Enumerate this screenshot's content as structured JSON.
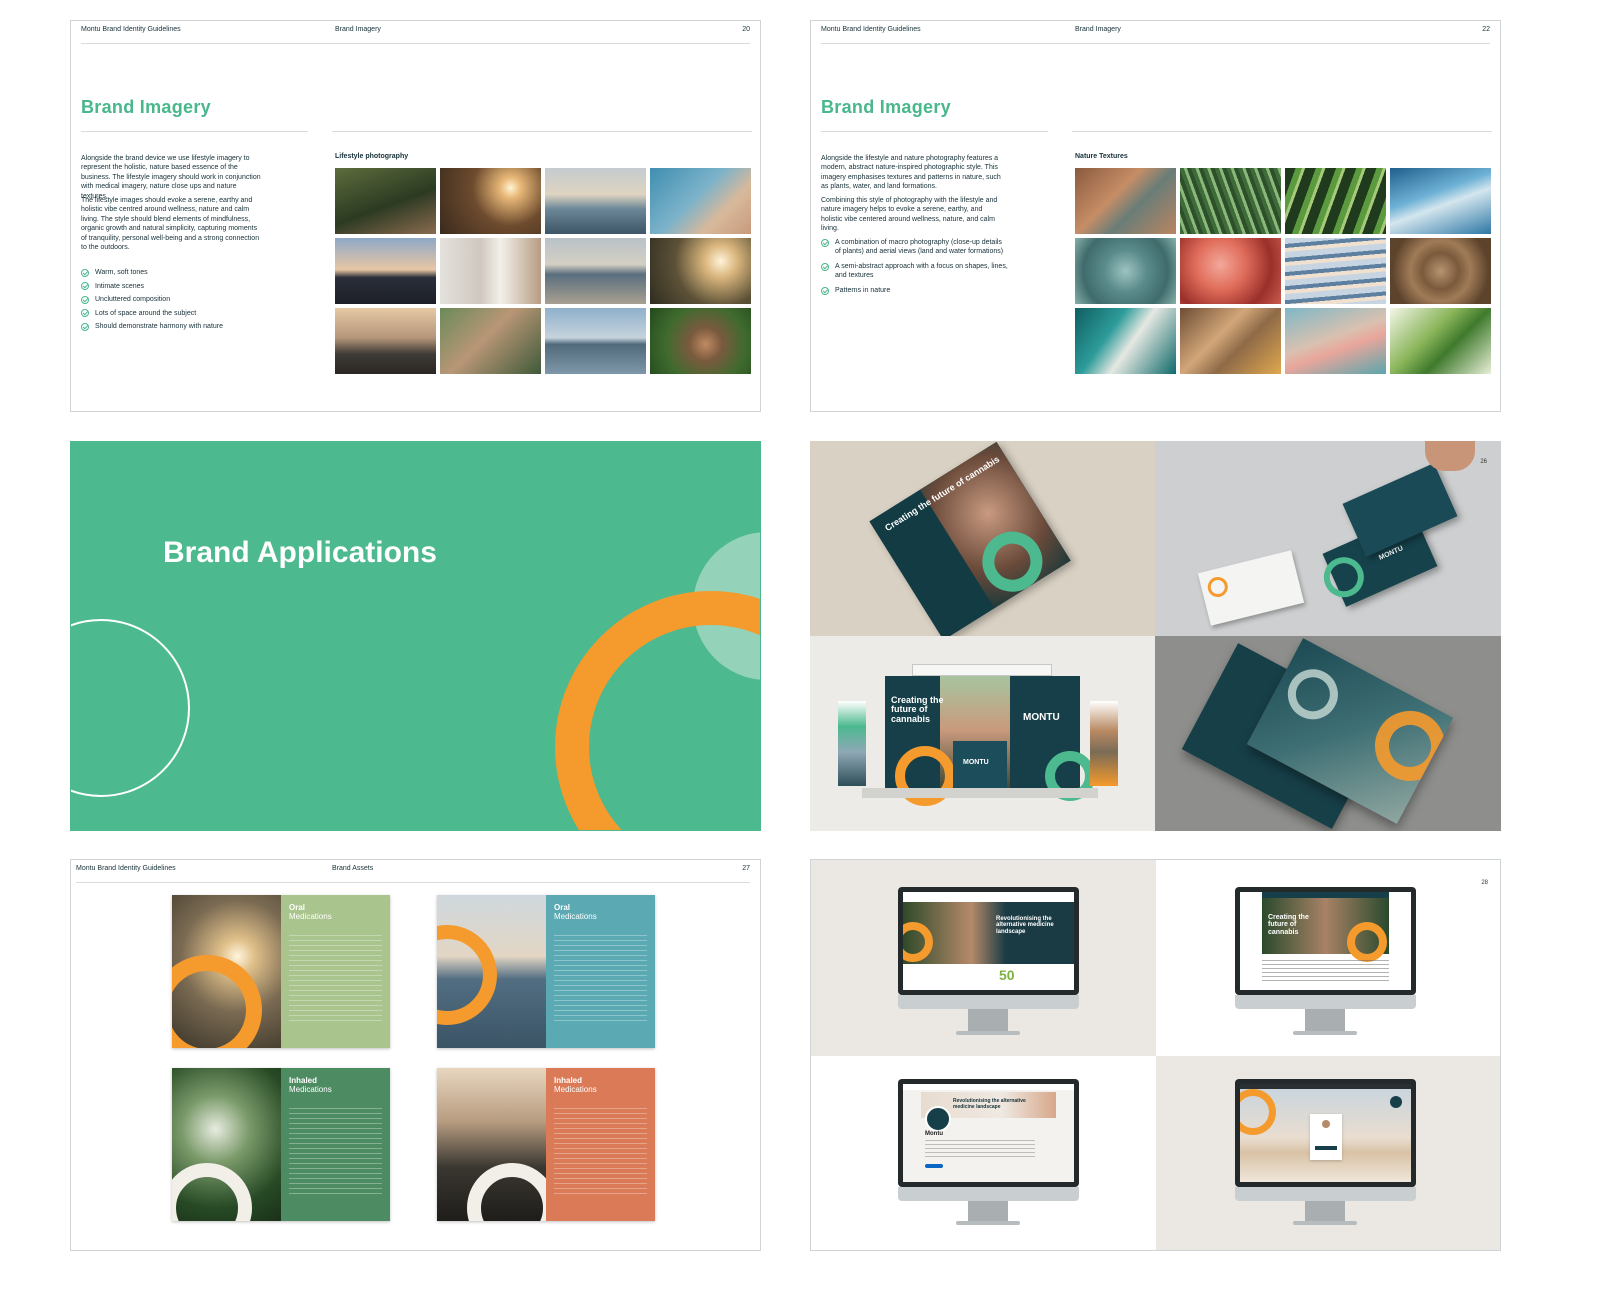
{
  "page1": {
    "header_left": "Montu Brand Identity Guidelines",
    "header_mid": "Brand Imagery",
    "page_number": "20",
    "title": "Brand Imagery",
    "para1": "Alongside the brand device we use lifestyle imagery to represent the holistic, nature based essence of the business. The lifestyle imagery should work in conjunction with medical imagery, nature close ups and nature textures.",
    "para2": "The lifestyle images should evoke a serene, earthy and holistic vibe centred around wellness, nature and calm living. The style should blend elements of mindfulness, organic growth and natural simplicity, capturing moments of tranquility, personal well-being and a strong connection to the outdoors.",
    "checks": [
      "Warm, soft tones",
      "Intimate scenes",
      "Uncluttered composition",
      "Lots of space around the subject",
      "Should demonstrate harmony with nature"
    ],
    "grid_label": "Lifestyle photography"
  },
  "page2": {
    "header_left": "Montu Brand Identity Guidelines",
    "header_mid": "Brand Imagery",
    "page_number": "22",
    "title": "Brand Imagery",
    "para1": "Alongside the lifestyle and nature photography features a modern, abstract nature-inspired photographic style. This imagery emphasises textures and patterns in nature, such as plants, water, and land formations.",
    "para2": "Combining this style of photography with the lifestyle and nature imagery helps to evoke a serene, earthy, and holistic vibe centered around wellness, nature, and calm living.",
    "checks": [
      "A combination of macro photography (close-up details of plants) and aerial views (land and water formations)",
      "A semi-abstract approach with a focus on shapes, lines, and textures",
      "Patterns in nature"
    ],
    "grid_label": "Nature Textures"
  },
  "page3": {
    "title": "Brand Applications",
    "colors": {
      "green": "#4cb98f",
      "orange": "#f59a2c"
    }
  },
  "page4": {
    "page_number": "26",
    "booth_text": "Creating the future of cannabis",
    "brand": "MONTU"
  },
  "page5": {
    "header_left": "Montu Brand Identity Guidelines",
    "header_mid": "Brand Assets",
    "page_number": "27",
    "spreads": [
      {
        "title_a": "Oral",
        "title_b": "Medications",
        "color": "#a9c48c"
      },
      {
        "title_a": "Oral",
        "title_b": "Medications",
        "color": "#5aa9b3"
      },
      {
        "title_a": "Inhaled",
        "title_b": "Medications",
        "color": "#4d8b63"
      },
      {
        "title_a": "Inhaled",
        "title_b": "Medications",
        "color": "#db7a57"
      }
    ]
  },
  "page6": {
    "page_number": "28",
    "web_headline": "Revolutionising the alternative medicine landscape",
    "web_stat": "50",
    "web2_text": "Creating the future of cannabis",
    "linkedin_name": "Montu",
    "linkedin_banner": "Revolutionising the alternative medicine landscape"
  }
}
